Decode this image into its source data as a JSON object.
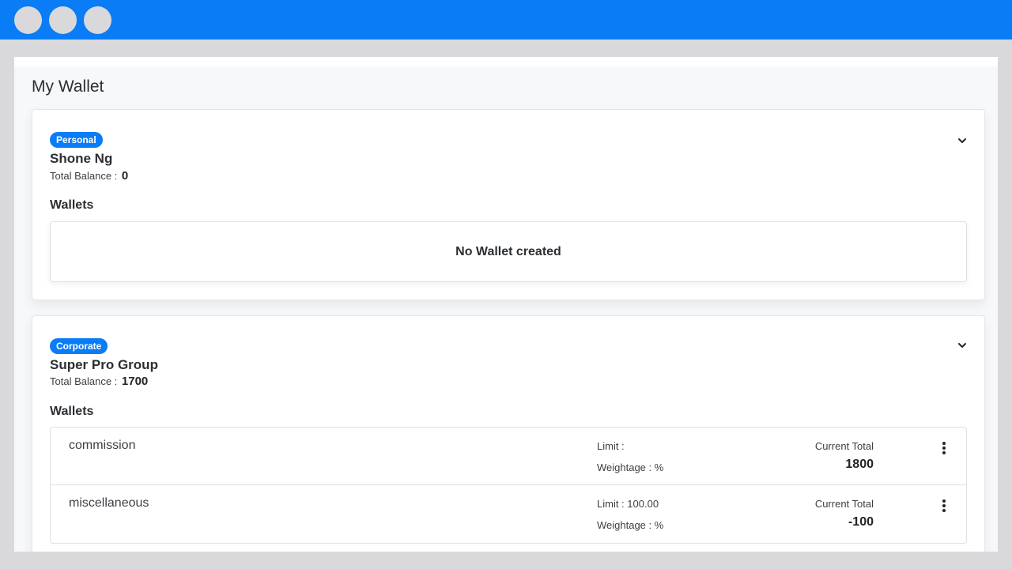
{
  "page": {
    "title": "My Wallet"
  },
  "accounts": [
    {
      "badge": "Personal",
      "name": "Shone Ng",
      "balance_label": "Total Balance :",
      "balance_value": "0",
      "wallets_heading": "Wallets",
      "empty_text": "No Wallet created"
    },
    {
      "badge": "Corporate",
      "name": "Super Pro Group",
      "balance_label": "Total Balance :",
      "balance_value": "1700",
      "wallets_heading": "Wallets",
      "wallets": [
        {
          "name": "commission",
          "limit": "Limit :",
          "weightage": "Weightage : %",
          "total_label": "Current Total",
          "total": "1800"
        },
        {
          "name": "miscellaneous",
          "limit": "Limit : 100.00",
          "weightage": "Weightage : %",
          "total_label": "Current Total",
          "total": "-100"
        }
      ]
    }
  ],
  "icons": {
    "collapse": "chevron-down-icon",
    "menu": "kebab-menu-icon"
  },
  "colors": {
    "accent": "#0a7cf6",
    "background": "#d9d9dc"
  }
}
